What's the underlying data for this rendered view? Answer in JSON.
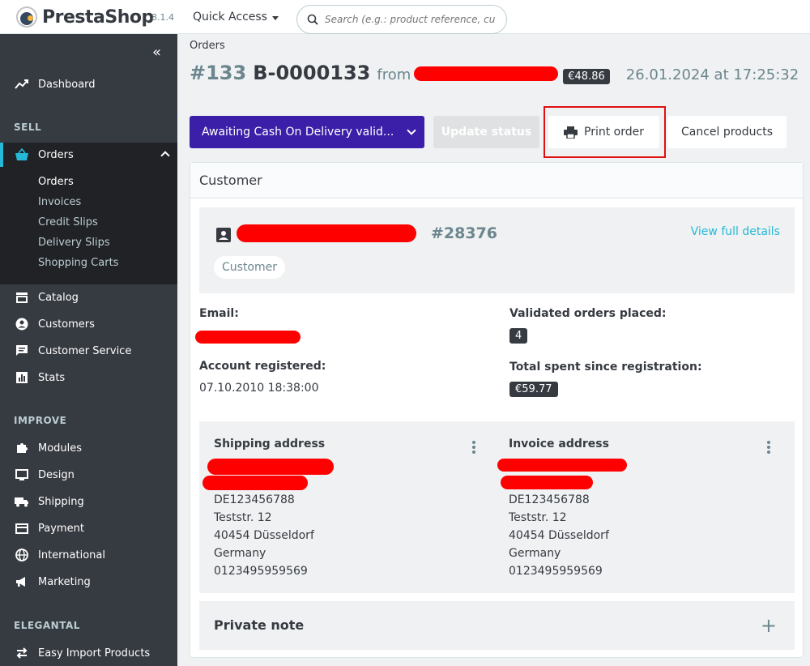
{
  "header": {
    "logo_text": "PrestaShop",
    "version": "8.1.4",
    "quick_access": "Quick Access",
    "search_placeholder": "Search (e.g.: product reference, custom"
  },
  "sidebar": {
    "dashboard": "Dashboard",
    "sections": {
      "sell": "SELL",
      "improve": "IMPROVE",
      "elegantal": "ELEGANTAL"
    },
    "orders": "Orders",
    "orders_sub": [
      "Orders",
      "Invoices",
      "Credit Slips",
      "Delivery Slips",
      "Shopping Carts"
    ],
    "sell_items": [
      "Catalog",
      "Customers",
      "Customer Service",
      "Stats"
    ],
    "improve_items": [
      "Modules",
      "Design",
      "Shipping",
      "Payment",
      "International",
      "Marketing"
    ],
    "elegantal_items": [
      "Easy Import Products"
    ]
  },
  "page": {
    "breadcrumb": "Orders",
    "order_number": "#133",
    "order_reference": "B-0000133",
    "from_label": "from",
    "total": "€48.86",
    "date": "26.01.2024 at 17:25:32"
  },
  "toolbar": {
    "status": "Awaiting Cash On Delivery valid...",
    "update_status": "Update status",
    "print_order": "Print order",
    "cancel_products": "Cancel products"
  },
  "customer": {
    "card_title": "Customer",
    "customer_id": "#28376",
    "view_full_details": "View full details",
    "badge": "Customer",
    "email_label": "Email:",
    "account_registered_label": "Account registered:",
    "account_registered_value": "07.10.2010 18:38:00",
    "validated_orders_label": "Validated orders placed:",
    "validated_orders_value": "4",
    "total_spent_label": "Total spent since registration:",
    "total_spent_value": "€59.77"
  },
  "shipping": {
    "title": "Shipping address",
    "lines": [
      "DE123456788",
      "Teststr. 12",
      "40454 Düsseldorf",
      "Germany",
      "0123495959569"
    ]
  },
  "invoice": {
    "title": "Invoice address",
    "lines": [
      "DE123456788",
      "Teststr. 12",
      "40454 Düsseldorf",
      "Germany",
      "0123495959569"
    ]
  },
  "private_note": {
    "title": "Private note",
    "toggle": "+"
  },
  "colors": {
    "sidebar_bg": "#363a41",
    "accent": "#25b9d7",
    "status_bg": "#3b1fa8",
    "redaction": "#ff0000",
    "highlight_border": "#e01010"
  }
}
